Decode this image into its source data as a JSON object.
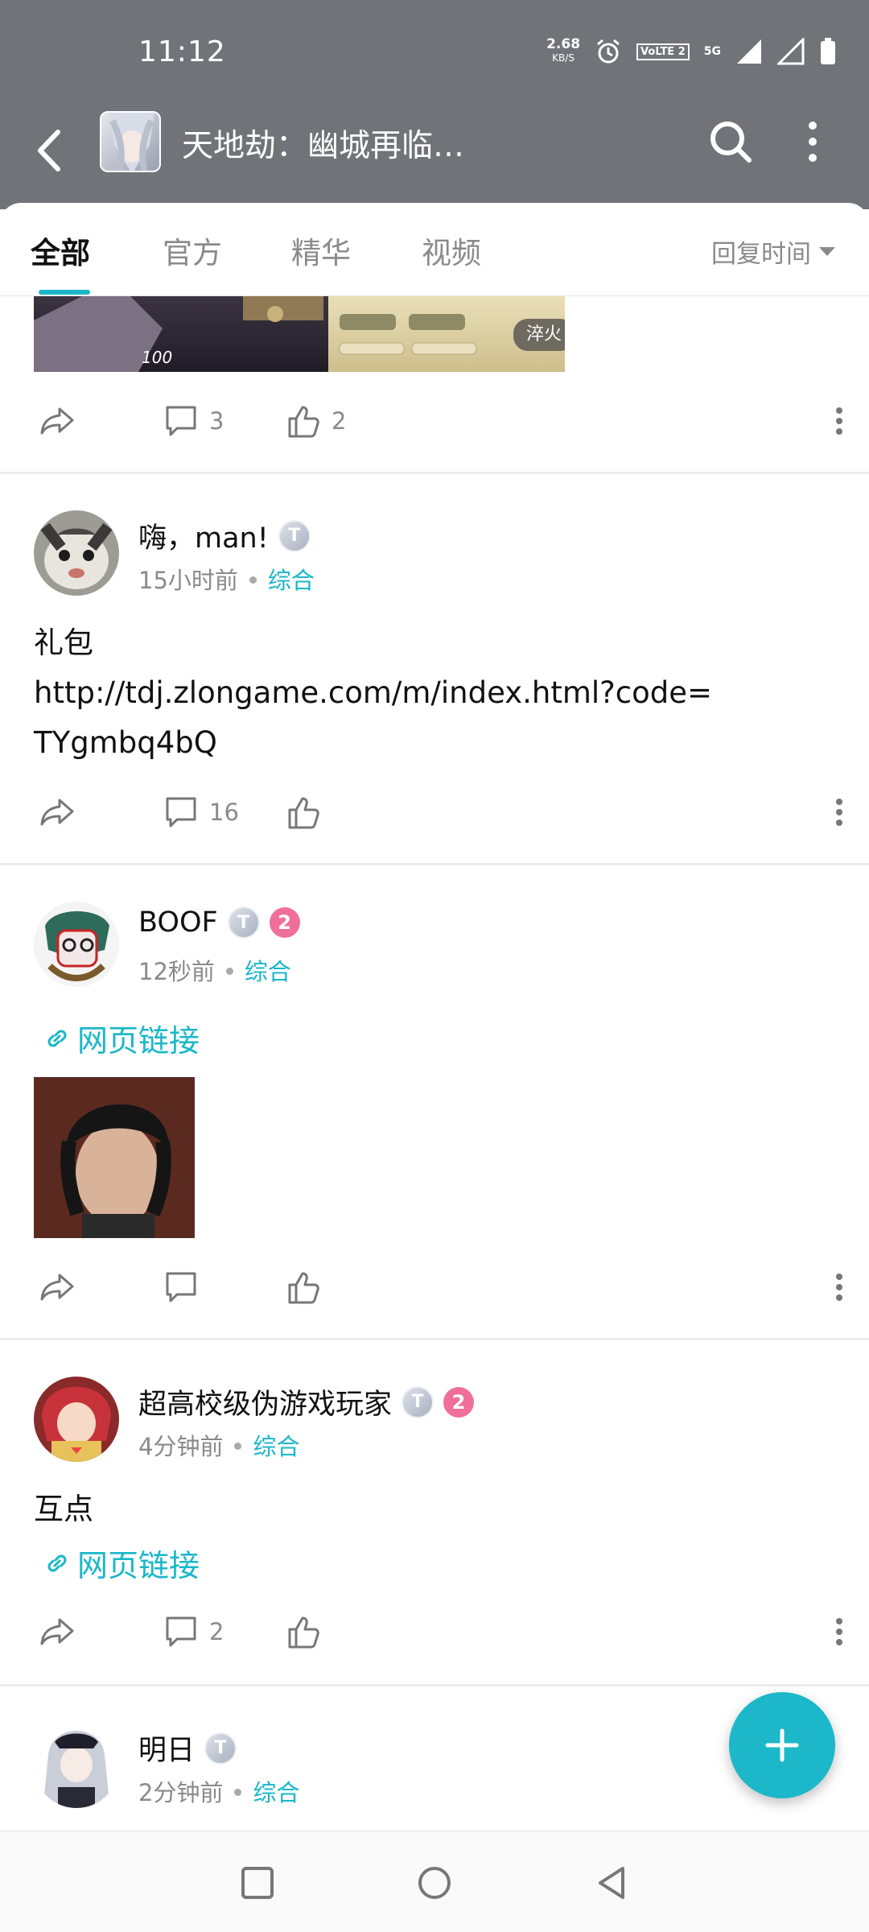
{
  "status_bar": {
    "time": "11:12",
    "net_speed": "2.68",
    "net_unit": "KB/S",
    "volte": "VoLTE 2",
    "network": "5G"
  },
  "header": {
    "title": "天地劫：幽城再临…"
  },
  "tabs": [
    {
      "label": "全部"
    },
    {
      "label": "官方"
    },
    {
      "label": "精华"
    },
    {
      "label": "视频"
    }
  ],
  "sort": {
    "label": "回复时间"
  },
  "partial_post": {
    "level_text": "100",
    "stamp_text": "淬火",
    "comment_count": "3",
    "like_count": "2"
  },
  "posts": [
    {
      "username": "嗨，man!",
      "badge_t": "T",
      "time": "15小时前",
      "category": "综合",
      "text_lines": [
        "礼包",
        "http://tdj.zlongame.com/m/index.html?code=",
        "TYgmbq4bQ"
      ],
      "comment_count": "16",
      "like_count": ""
    },
    {
      "username": "BOOF",
      "badge_t": "T",
      "badge_level": "2",
      "time": "12秒前",
      "category": "综合",
      "link_label": "网页链接",
      "comment_count": "",
      "like_count": ""
    },
    {
      "username": "超高校级伪游戏玩家",
      "badge_t": "T",
      "badge_level": "2",
      "time": "4分钟前",
      "category": "综合",
      "text_lines": [
        "互点"
      ],
      "link_label": "网页链接",
      "comment_count": "2",
      "like_count": ""
    },
    {
      "username": "明日",
      "badge_t": "T",
      "time": "2分钟前",
      "category": "综合"
    }
  ],
  "colors": {
    "accent": "#19b7c8",
    "header_bg": "#707478",
    "badge_pink": "#f06f9a"
  }
}
